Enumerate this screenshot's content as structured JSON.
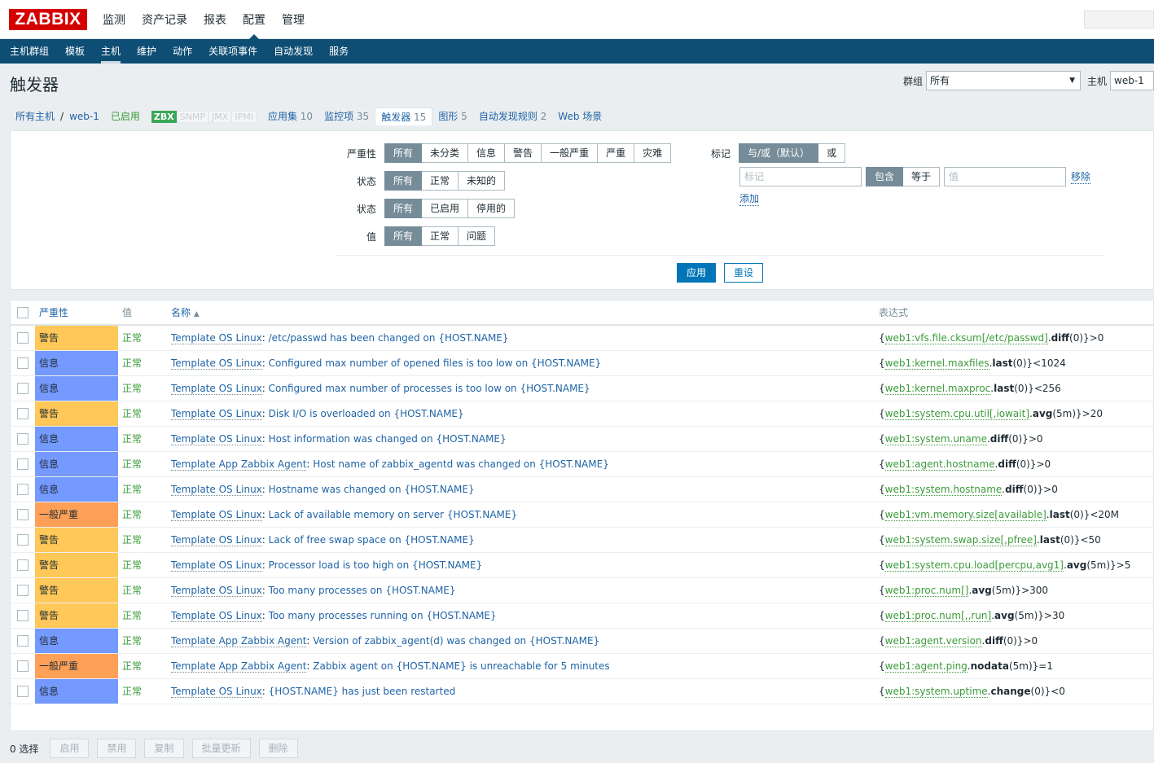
{
  "logo": "ZABBIX",
  "main_menu": [
    {
      "label": "监测"
    },
    {
      "label": "资产记录"
    },
    {
      "label": "报表"
    },
    {
      "label": "配置"
    },
    {
      "label": "管理"
    }
  ],
  "sub_menu": [
    {
      "label": "主机群组"
    },
    {
      "label": "模板"
    },
    {
      "label": "主机"
    },
    {
      "label": "维护"
    },
    {
      "label": "动作"
    },
    {
      "label": "关联项事件"
    },
    {
      "label": "自动发现"
    },
    {
      "label": "服务"
    }
  ],
  "page_title": "触发器",
  "header_filters": {
    "group_label": "群组",
    "group_value": "所有",
    "host_label": "主机",
    "host_value": "web-1"
  },
  "hostnav": {
    "all_hosts": "所有主机",
    "sep": "/",
    "host": "web-1",
    "enabled": "已启用",
    "zbx": "ZBX",
    "snmp": "SNMP",
    "jmx": "JMX",
    "ipmi": "IPMI",
    "applications": "应用集",
    "applications_count": "10",
    "items": "监控项",
    "items_count": "35",
    "triggers": "触发器",
    "triggers_count": "15",
    "graphs": "图形",
    "graphs_count": "5",
    "discovery": "自动发现规则",
    "discovery_count": "2",
    "web": "Web 场景"
  },
  "filter": {
    "severity_label": "严重性",
    "severity_options": [
      "所有",
      "未分类",
      "信息",
      "警告",
      "一般严重",
      "严重",
      "灾难"
    ],
    "state_label": "状态",
    "state_options": [
      "所有",
      "正常",
      "未知的"
    ],
    "status_label": "状态",
    "status_options": [
      "所有",
      "已启用",
      "停用的"
    ],
    "value_label": "值",
    "value_options": [
      "所有",
      "正常",
      "问题"
    ],
    "tags_label": "标记",
    "tags_mode": [
      "与/或（默认）",
      "或"
    ],
    "tag_placeholder": "标记",
    "tag_op": [
      "包含",
      "等于"
    ],
    "tag_value_placeholder": "值",
    "remove": "移除",
    "add": "添加",
    "apply": "应用",
    "reset": "重设"
  },
  "table": {
    "headers": {
      "severity": "严重性",
      "value": "值",
      "name": "名称",
      "expression": "表达式"
    },
    "rows": [
      {
        "severity": "警告",
        "sev": "warn",
        "value": "正常",
        "template": "Template OS Linux",
        "name": "/etc/passwd has been changed on {HOST.NAME}",
        "e_pre": "{",
        "e_key": "web1:vfs.file.cksum[/etc/passwd]",
        "e_mid": ".",
        "e_func": "diff",
        "e_post": "(0)}>0"
      },
      {
        "severity": "信息",
        "sev": "info",
        "value": "正常",
        "template": "Template OS Linux",
        "name": "Configured max number of opened files is too low on {HOST.NAME}",
        "e_pre": "{",
        "e_key": "web1:kernel.maxfiles",
        "e_mid": ".",
        "e_func": "last",
        "e_post": "(0)}<1024"
      },
      {
        "severity": "信息",
        "sev": "info",
        "value": "正常",
        "template": "Template OS Linux",
        "name": "Configured max number of processes is too low on {HOST.NAME}",
        "e_pre": "{",
        "e_key": "web1:kernel.maxproc",
        "e_mid": ".",
        "e_func": "last",
        "e_post": "(0)}<256"
      },
      {
        "severity": "警告",
        "sev": "warn",
        "value": "正常",
        "template": "Template OS Linux",
        "name": "Disk I/O is overloaded on {HOST.NAME}",
        "e_pre": "{",
        "e_key": "web1:system.cpu.util[,iowait]",
        "e_mid": ".",
        "e_func": "avg",
        "e_post": "(5m)}>20"
      },
      {
        "severity": "信息",
        "sev": "info",
        "value": "正常",
        "template": "Template OS Linux",
        "name": "Host information was changed on {HOST.NAME}",
        "e_pre": "{",
        "e_key": "web1:system.uname",
        "e_mid": ".",
        "e_func": "diff",
        "e_post": "(0)}>0"
      },
      {
        "severity": "信息",
        "sev": "info",
        "value": "正常",
        "template": "Template App Zabbix Agent",
        "name": "Host name of zabbix_agentd was changed on {HOST.NAME}",
        "e_pre": "{",
        "e_key": "web1:agent.hostname",
        "e_mid": ".",
        "e_func": "diff",
        "e_post": "(0)}>0"
      },
      {
        "severity": "信息",
        "sev": "info",
        "value": "正常",
        "template": "Template OS Linux",
        "name": "Hostname was changed on {HOST.NAME}",
        "e_pre": "{",
        "e_key": "web1:system.hostname",
        "e_mid": ".",
        "e_func": "diff",
        "e_post": "(0)}>0"
      },
      {
        "severity": "一般严重",
        "sev": "avg",
        "value": "正常",
        "template": "Template OS Linux",
        "name": "Lack of available memory on server {HOST.NAME}",
        "e_pre": "{",
        "e_key": "web1:vm.memory.size[available]",
        "e_mid": ".",
        "e_func": "last",
        "e_post": "(0)}<20M"
      },
      {
        "severity": "警告",
        "sev": "warn",
        "value": "正常",
        "template": "Template OS Linux",
        "name": "Lack of free swap space on {HOST.NAME}",
        "e_pre": "{",
        "e_key": "web1:system.swap.size[,pfree]",
        "e_mid": ".",
        "e_func": "last",
        "e_post": "(0)}<50"
      },
      {
        "severity": "警告",
        "sev": "warn",
        "value": "正常",
        "template": "Template OS Linux",
        "name": "Processor load is too high on {HOST.NAME}",
        "e_pre": "{",
        "e_key": "web1:system.cpu.load[percpu,avg1]",
        "e_mid": ".",
        "e_func": "avg",
        "e_post": "(5m)}>5"
      },
      {
        "severity": "警告",
        "sev": "warn",
        "value": "正常",
        "template": "Template OS Linux",
        "name": "Too many processes on {HOST.NAME}",
        "e_pre": "{",
        "e_key": "web1:proc.num[]",
        "e_mid": ".",
        "e_func": "avg",
        "e_post": "(5m)}>300"
      },
      {
        "severity": "警告",
        "sev": "warn",
        "value": "正常",
        "template": "Template OS Linux",
        "name": "Too many processes running on {HOST.NAME}",
        "e_pre": "{",
        "e_key": "web1:proc.num[,,run]",
        "e_mid": ".",
        "e_func": "avg",
        "e_post": "(5m)}>30"
      },
      {
        "severity": "信息",
        "sev": "info",
        "value": "正常",
        "template": "Template App Zabbix Agent",
        "name": "Version of zabbix_agent(d) was changed on {HOST.NAME}",
        "e_pre": "{",
        "e_key": "web1:agent.version",
        "e_mid": ".",
        "e_func": "diff",
        "e_post": "(0)}>0"
      },
      {
        "severity": "一般严重",
        "sev": "avg",
        "value": "正常",
        "template": "Template App Zabbix Agent",
        "name": "Zabbix agent on {HOST.NAME} is unreachable for 5 minutes",
        "e_pre": "{",
        "e_key": "web1:agent.ping",
        "e_mid": ".",
        "e_func": "nodata",
        "e_post": "(5m)}=1"
      },
      {
        "severity": "信息",
        "sev": "info",
        "value": "正常",
        "template": "Template OS Linux",
        "name": "{HOST.NAME} has just been restarted",
        "e_pre": "{",
        "e_key": "web1:system.uptime",
        "e_mid": ".",
        "e_func": "change",
        "e_post": "(0)}<0"
      }
    ]
  },
  "footer": {
    "selected": "0 选择",
    "buttons": [
      "启用",
      "禁用",
      "复制",
      "批量更新",
      "删除"
    ]
  },
  "colors": {
    "header_bg": "#0e4e74",
    "logo_red": "#d40000",
    "warning": "#ffc859",
    "information": "#7499ff",
    "average": "#ffa059",
    "ok_green": "#3b9b3a",
    "link": "#1f64a6",
    "apply_blue": "#0275b8"
  }
}
